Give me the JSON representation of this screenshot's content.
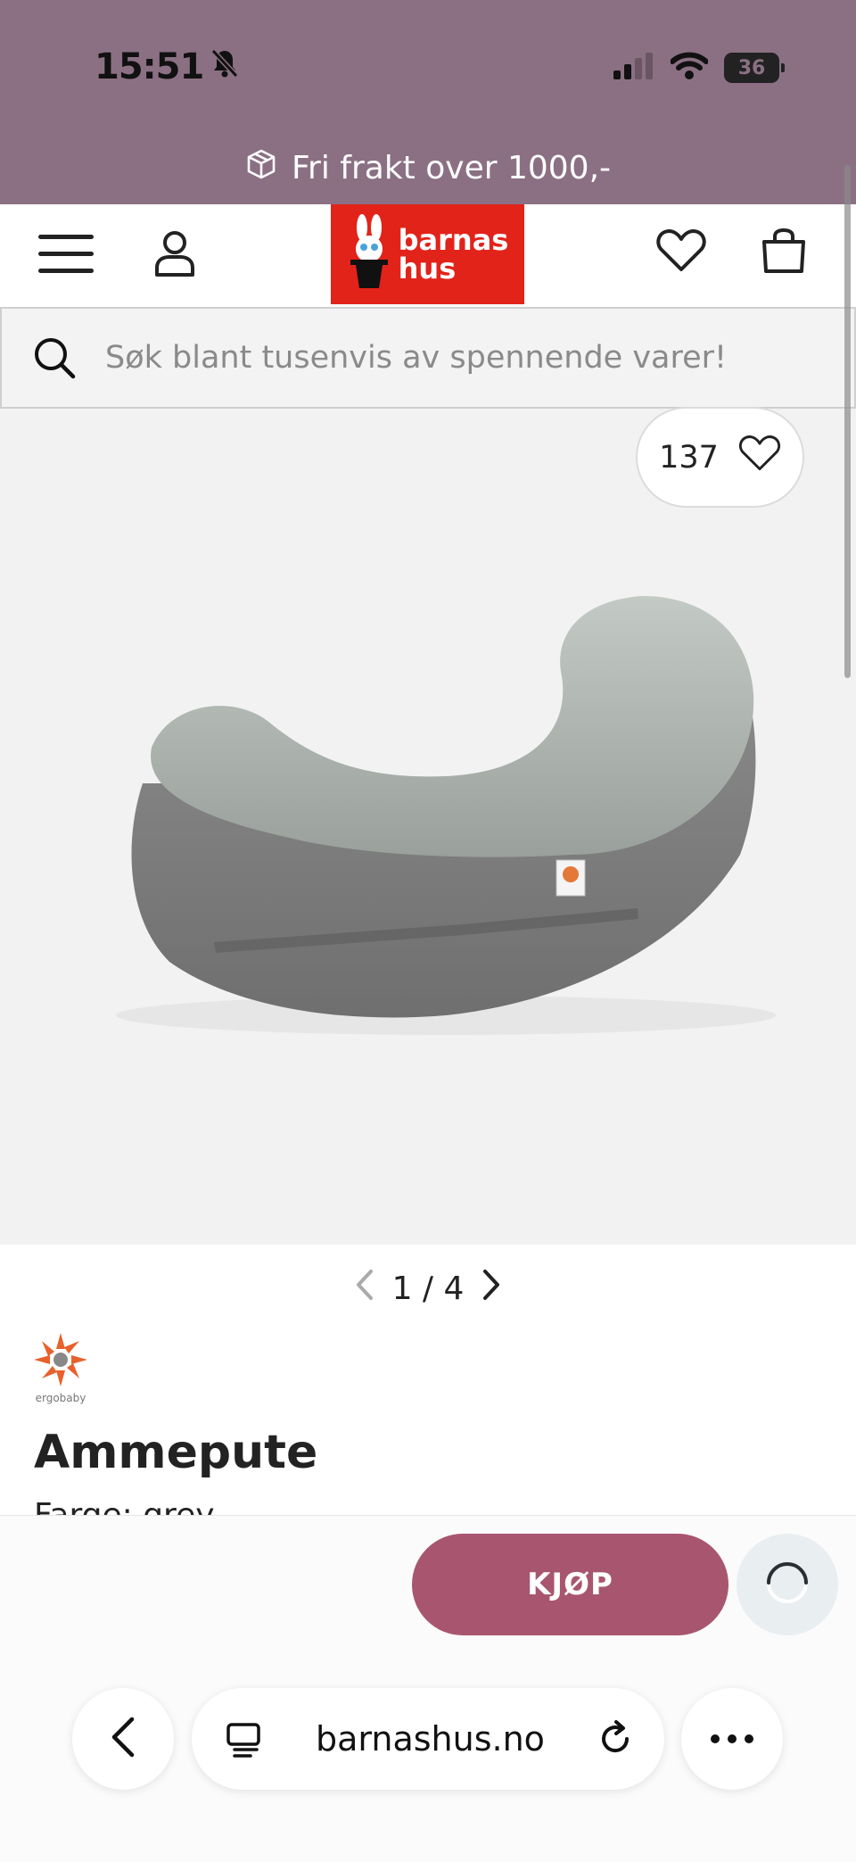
{
  "status_bar": {
    "time": "15:51",
    "battery": "36"
  },
  "promo": {
    "text": "Fri frakt over 1000,-"
  },
  "header": {
    "logo_line1": "barnas",
    "logo_line2": "hus"
  },
  "search": {
    "placeholder": "Søk blant tusenvis av spennende varer!"
  },
  "product": {
    "wishlist_count": "137",
    "gallery_position": "1 / 4",
    "brand": "ergobaby",
    "title": "Ammepute",
    "subtitle": "Farge: grey"
  },
  "actions": {
    "buy_label": "KJØP"
  },
  "browser": {
    "url": "barnashus.no"
  },
  "colors": {
    "topbar": "#8b7083",
    "logo_bg": "#e2231a",
    "buy_button": "#a8566f"
  }
}
